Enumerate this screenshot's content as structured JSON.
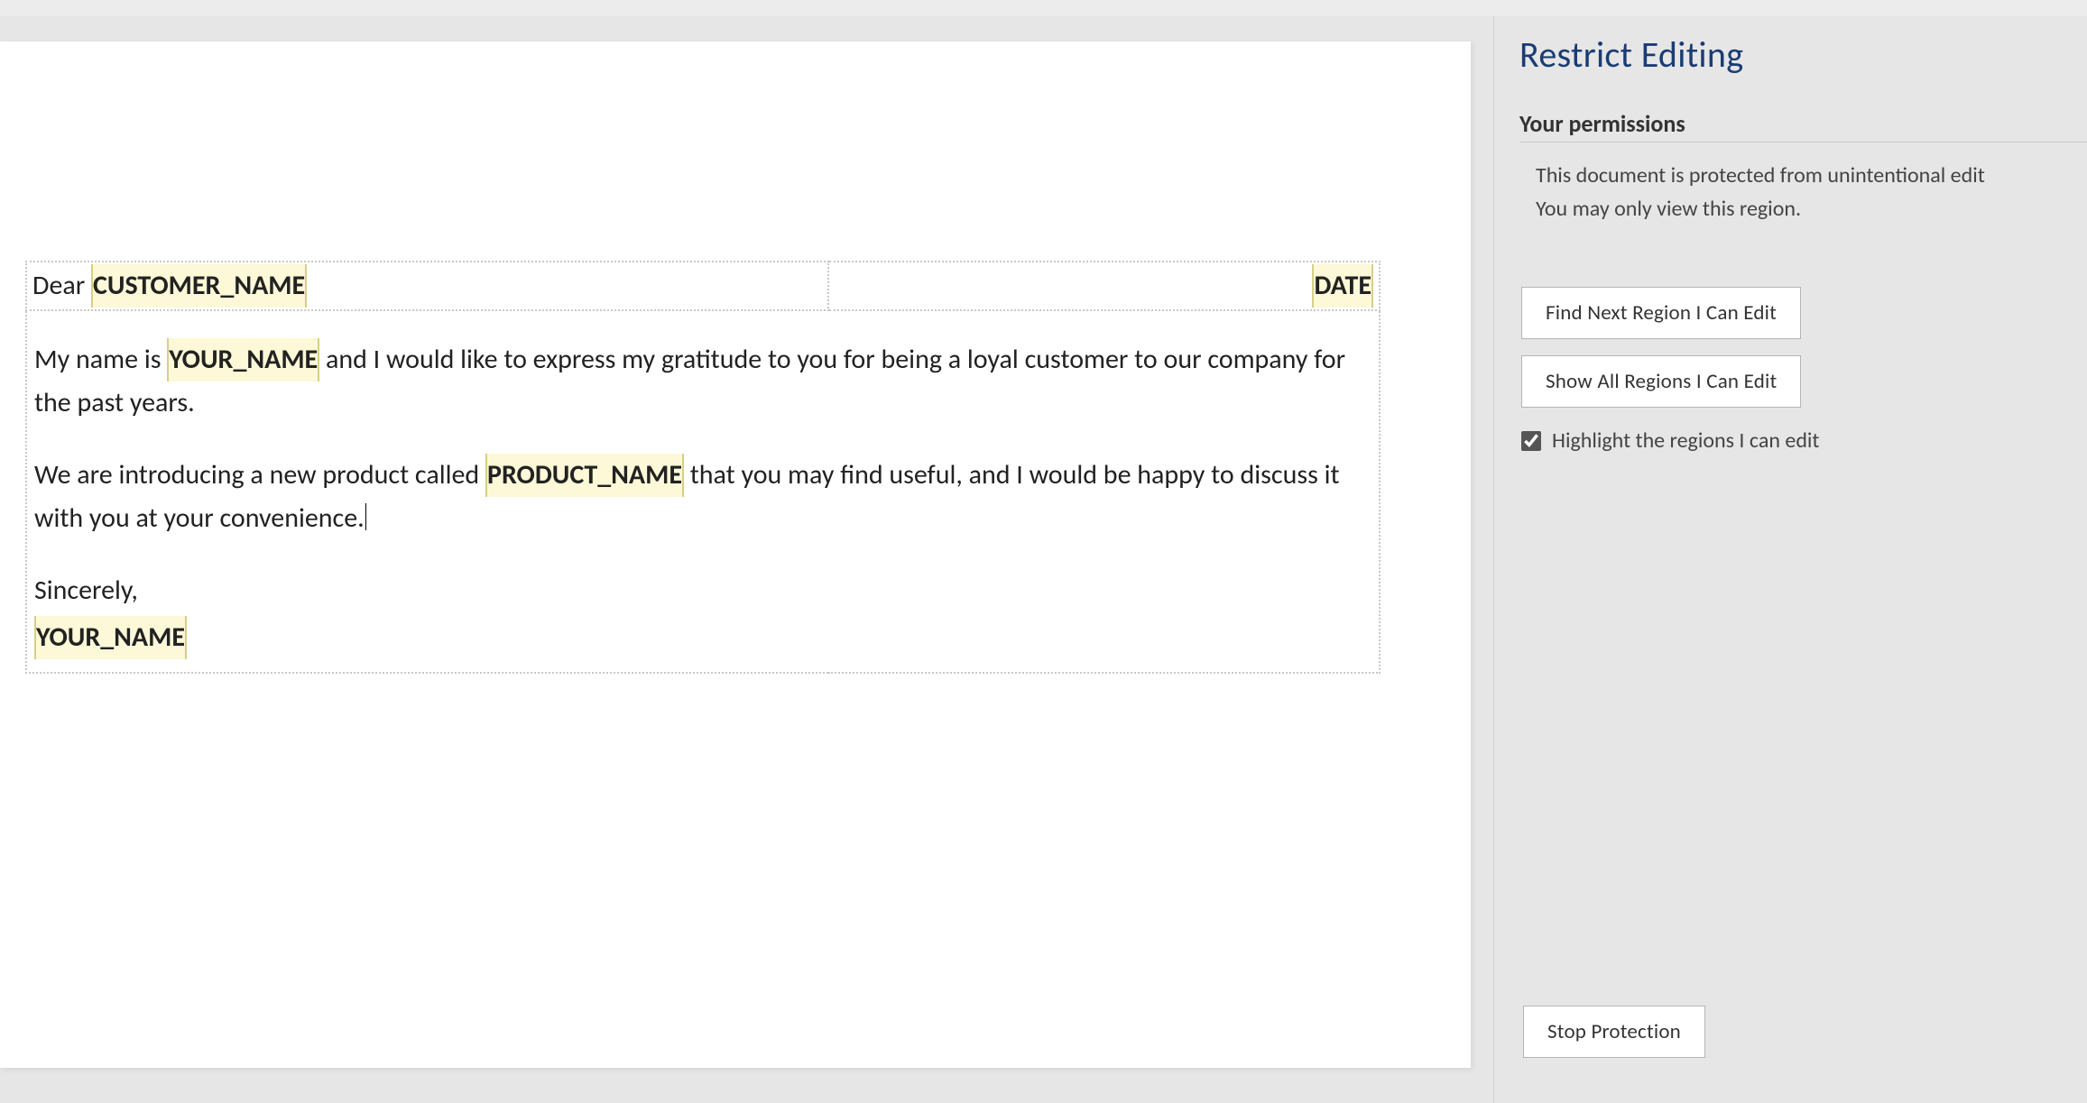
{
  "document": {
    "greeting_prefix": "Dear ",
    "placeholders": {
      "customer_name": "CUSTOMER_NAME",
      "date": "DATE",
      "your_name_inline": "YOUR_NAME",
      "product_name": "PRODUCT_NAME",
      "your_name_signature": "YOUR_NAME"
    },
    "body": {
      "p1_pre": "My name is ",
      "p1_post": " and I would like to express my gratitude to you for being a loyal customer to our company for the past years.",
      "p2_pre": "We are introducing a new product called ",
      "p2_post": " that you may find useful, and I would be happy to discuss it with you at your convenience.",
      "closing": "Sincerely,"
    }
  },
  "sidebar": {
    "title": "Restrict Editing",
    "permissions_header": "Your permissions",
    "permissions_line1": "This document is protected from unintentional edit",
    "permissions_line2": "You may only view this region.",
    "btn_find_next": "Find Next Region I Can Edit",
    "btn_show_all": "Show All Regions I Can Edit",
    "highlight_checkbox_label": "Highlight the regions I can edit",
    "highlight_checked": true,
    "btn_stop_protection": "Stop Protection"
  }
}
